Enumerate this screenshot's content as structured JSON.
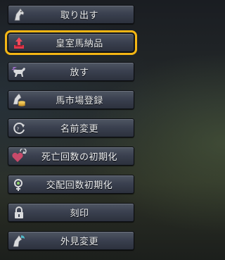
{
  "menu": {
    "items": [
      {
        "label": "取り出す",
        "icon": "horse-head-take-out-icon"
      },
      {
        "label": "皇室馬納品",
        "icon": "upload-tray-icon",
        "highlighted": true
      },
      {
        "label": "放す",
        "icon": "running-horse-icon"
      },
      {
        "label": "馬市場登録",
        "icon": "horse-coins-icon"
      },
      {
        "label": "名前変更",
        "icon": "rename-cycle-icon"
      },
      {
        "label": "死亡回数の初期化",
        "icon": "heart-refresh-icon"
      },
      {
        "label": "交配回数初期化",
        "icon": "gender-refresh-icon"
      },
      {
        "label": "刻印",
        "icon": "padlock-icon"
      },
      {
        "label": "外見変更",
        "icon": "horse-appearance-icon"
      }
    ]
  },
  "colors": {
    "highlight": "#f4b614",
    "button_text": "#eef0f2",
    "upload_icon": "#e2364a"
  }
}
